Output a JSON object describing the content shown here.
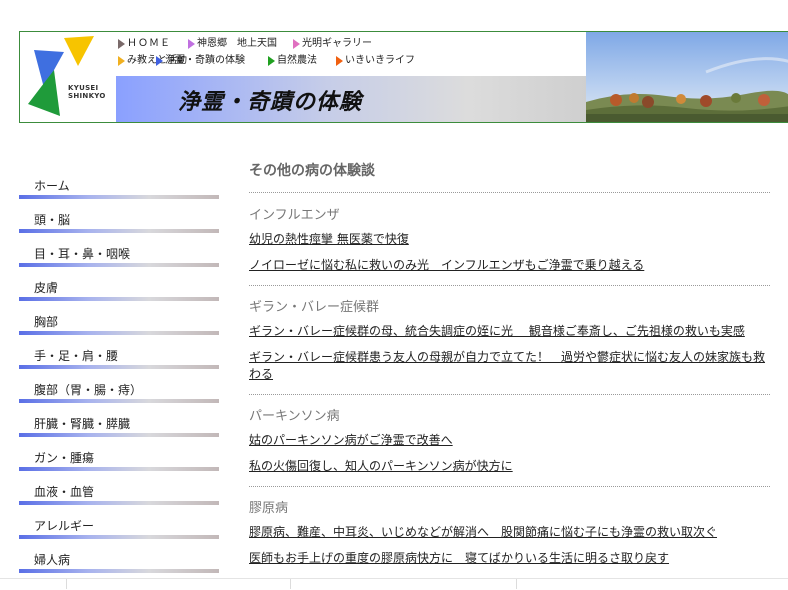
{
  "logo": {
    "line1": "KYUSEI",
    "line2": "SHINKYO"
  },
  "nav": {
    "row1": [
      {
        "label": "ＨＯＭＥ",
        "color": "#7a6a6a"
      },
      {
        "label": "神恩郷　地上天国",
        "color": "#c070e0"
      },
      {
        "label": "光明ギャラリー",
        "color": "#e070c0"
      }
    ],
    "row2": [
      {
        "label": "み教えと活動",
        "color": "#f0b020"
      },
      {
        "label": "浄霊・奇蹟の体験",
        "color": "#4060e0"
      },
      {
        "label": "自然農法",
        "color": "#20a020"
      },
      {
        "label": "いきいきライフ",
        "color": "#f06010"
      }
    ]
  },
  "header": {
    "title": "浄霊・奇蹟の体験"
  },
  "sidebar": {
    "items": [
      {
        "label": "ホーム"
      },
      {
        "label": "頭・脳"
      },
      {
        "label": "目・耳・鼻・咽喉"
      },
      {
        "label": "皮膚"
      },
      {
        "label": "胸部"
      },
      {
        "label": "手・足・肩・腰"
      },
      {
        "label": "腹部（胃・腸・痔）"
      },
      {
        "label": "肝臓・腎臓・膵臓"
      },
      {
        "label": "ガン・腫瘍"
      },
      {
        "label": "血液・血管"
      },
      {
        "label": "アレルギー"
      },
      {
        "label": "婦人病"
      }
    ]
  },
  "main": {
    "title": "その他の病の体験談",
    "sections": [
      {
        "title": "インフルエンザ",
        "links": [
          "幼児の熱性痙攣 無医薬で快復",
          "ノイローゼに悩む私に救いのみ光　インフルエンザもご浄霊で乗り越える"
        ]
      },
      {
        "title": "ギラン・バレー症候群",
        "links": [
          "ギラン・バレー症候群の母、統合失調症の姪に光　 観音様ご奉斎し、ご先祖様の救いも実感",
          "ギラン・バレー症候群患う友人の母親が自力で立てた！　過労や鬱症状に悩む友人の妹家族も救わる"
        ]
      },
      {
        "title": "パーキンソン病",
        "links": [
          "姑のパーキンソン病がご浄霊で改善へ",
          "私の火傷回復し、知人のパーキンソン病が快方に"
        ]
      },
      {
        "title": "膠原病",
        "links": [
          "膠原病、難産、中耳炎、いじめなどが解消へ　股関節痛に悩む子にも浄霊の救い取次ぐ",
          "医師もお手上げの重度の膠原病快方に　寝てばかりいる生活に明るさ取り戻す"
        ]
      }
    ]
  }
}
